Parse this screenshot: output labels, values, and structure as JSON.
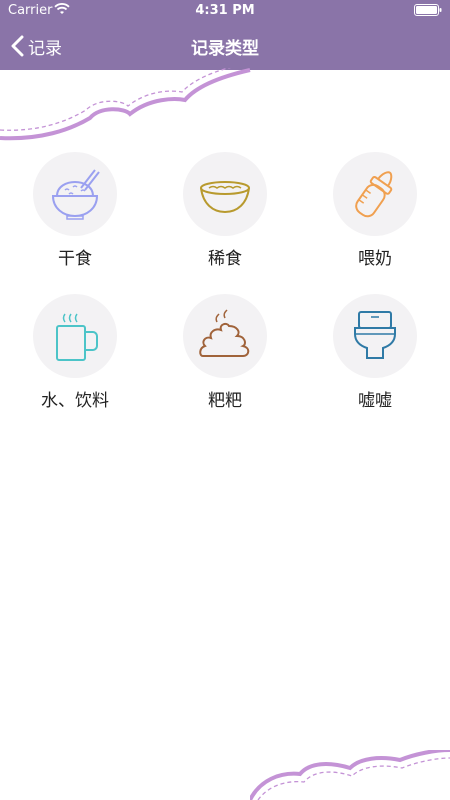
{
  "status_bar": {
    "carrier": "Carrier",
    "time": "4:31 PM"
  },
  "nav": {
    "back_label": "记录",
    "title": "记录类型"
  },
  "types": [
    {
      "label": "干食",
      "icon": "rice-bowl-icon",
      "color": "#9aa0f0"
    },
    {
      "label": "稀食",
      "icon": "porridge-bowl-icon",
      "color": "#b89a2e"
    },
    {
      "label": "喂奶",
      "icon": "baby-bottle-icon",
      "color": "#f0a050"
    },
    {
      "label": "水、饮料",
      "icon": "mug-icon",
      "color": "#4cc4c8"
    },
    {
      "label": "粑粑",
      "icon": "poop-icon",
      "color": "#a0633a"
    },
    {
      "label": "嘘嘘",
      "icon": "toilet-icon",
      "color": "#2f7aa6"
    }
  ],
  "colors": {
    "header": "#8a74a8",
    "decor": "#c493d6"
  }
}
